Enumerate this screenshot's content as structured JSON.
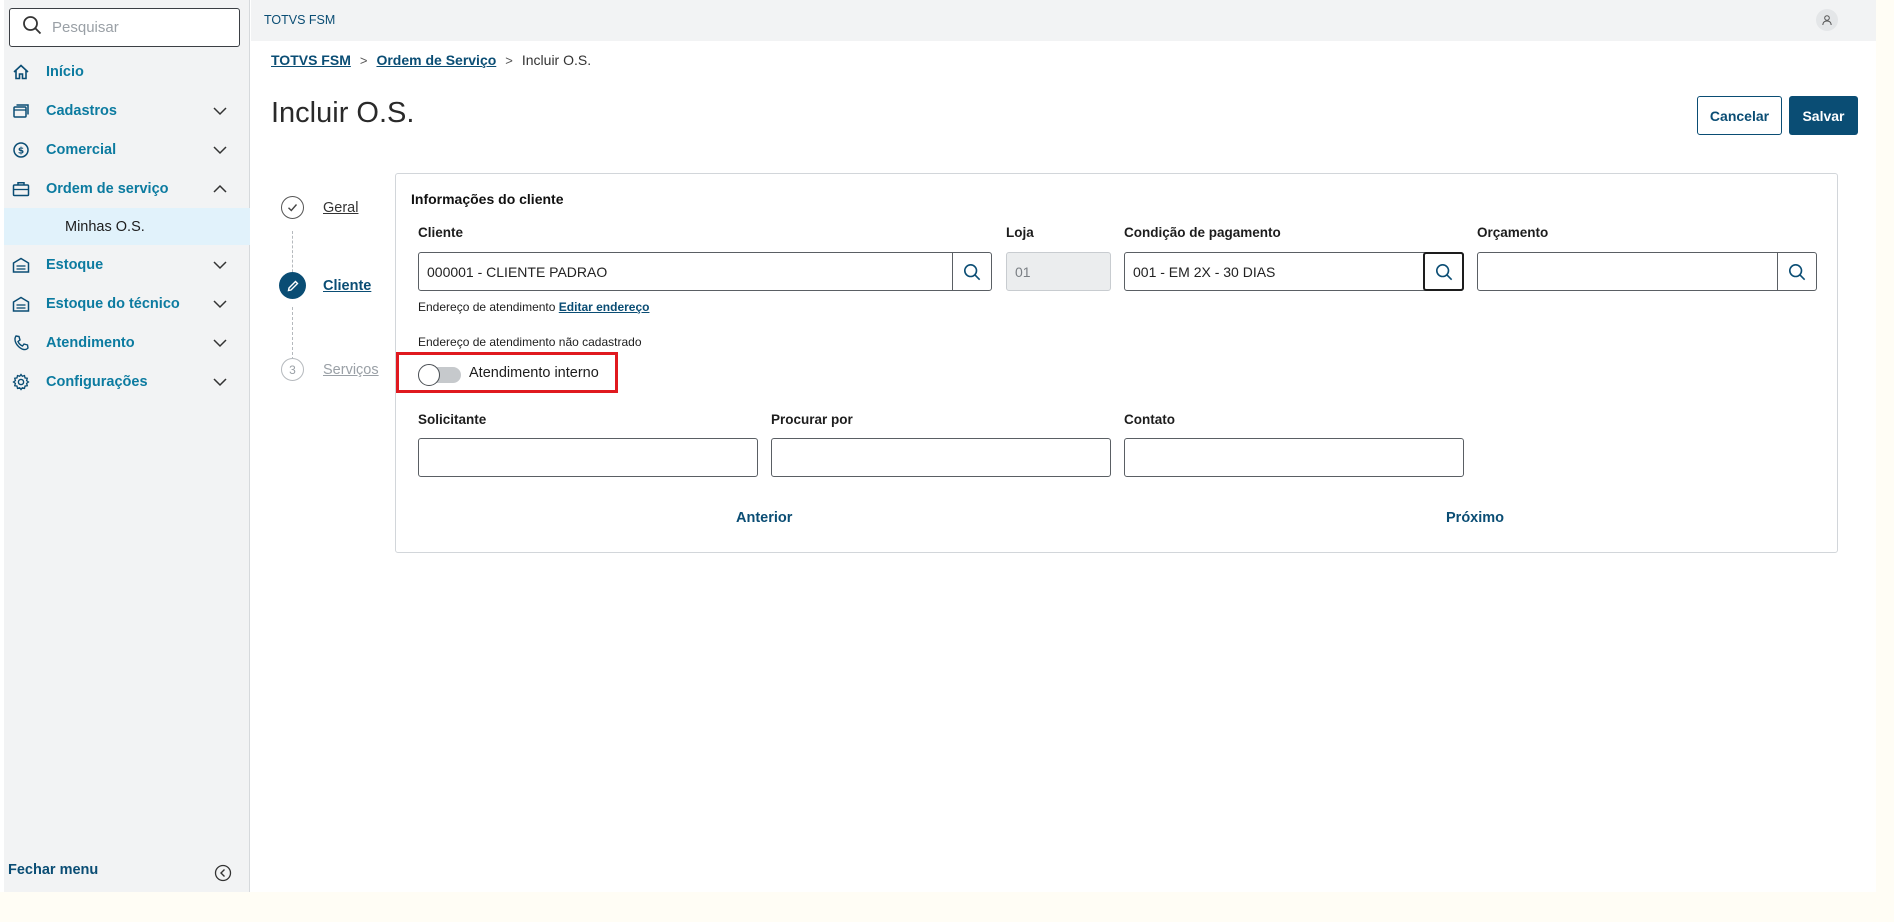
{
  "sidebar": {
    "search_placeholder": "Pesquisar",
    "items": [
      {
        "label": "Início",
        "icon": "home-icon"
      },
      {
        "label": "Cadastros",
        "icon": "cards-icon"
      },
      {
        "label": "Comercial",
        "icon": "money-icon"
      },
      {
        "label": "Ordem de serviço",
        "icon": "briefcase-icon"
      },
      {
        "label": "Estoque",
        "icon": "warehouse-icon"
      },
      {
        "label": "Estoque do técnico",
        "icon": "warehouse-icon"
      },
      {
        "label": "Atendimento",
        "icon": "phone-icon"
      },
      {
        "label": "Configurações",
        "icon": "gear-icon"
      }
    ],
    "subitem": "Minhas O.S.",
    "close_menu": "Fechar menu"
  },
  "topbar": {
    "brand": "TOTVS FSM"
  },
  "breadcrumb": {
    "home": "TOTVS FSM",
    "parent": "Ordem de Serviço",
    "current": "Incluir O.S."
  },
  "page": {
    "title": "Incluir O.S.",
    "cancel": "Cancelar",
    "save": "Salvar"
  },
  "steps": [
    {
      "number": "",
      "label": "Geral",
      "state": "done"
    },
    {
      "number": "",
      "label": "Cliente",
      "state": "active"
    },
    {
      "number": "3",
      "label": "Serviços",
      "state": "pending"
    }
  ],
  "form": {
    "section_title": "Informações do cliente",
    "cliente": {
      "label": "Cliente",
      "value": "000001 - CLIENTE PADRAO"
    },
    "loja": {
      "label": "Loja",
      "value": "01"
    },
    "condicao": {
      "label": "Condição de pagamento",
      "value": "001 - EM 2X - 30 DIAS"
    },
    "orcamento": {
      "label": "Orçamento",
      "value": ""
    },
    "endereco_text": "Endereço de atendimento",
    "endereco_link": "Editar endereço",
    "endereco_status": "Endereço de atendimento não cadastrado",
    "toggle_label": "Atendimento interno",
    "toggle_on": false,
    "solicitante": {
      "label": "Solicitante",
      "value": ""
    },
    "procurar": {
      "label": "Procurar por",
      "value": ""
    },
    "contato": {
      "label": "Contato",
      "value": ""
    },
    "prev": "Anterior",
    "next": "Próximo"
  },
  "colors": {
    "primary": "#0a4d74",
    "accent": "#0c7ba0",
    "highlight": "#e0191f"
  }
}
